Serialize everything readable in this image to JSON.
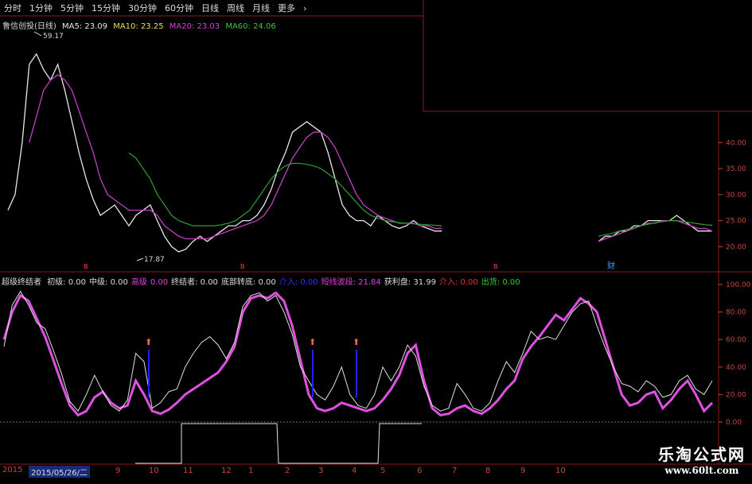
{
  "topbar": {
    "tabs": [
      "分时",
      "1分钟",
      "5分钟",
      "15分钟",
      "30分钟",
      "60分钟",
      "日线",
      "周线",
      "月线",
      "更多",
      "›"
    ]
  },
  "stock_header": {
    "name": "鲁信创投(日线)",
    "ma5": "MA5: 23.09",
    "ma10": "MA10: 23.25",
    "ma20": "MA20: 23.03",
    "ma60": "MA60: 24.06"
  },
  "indicator_header": {
    "name": "超级终结者",
    "items": [
      {
        "text": "初级: 0.00",
        "color": "#dddddd"
      },
      {
        "text": "中级: 0.00",
        "color": "#dddddd"
      },
      {
        "text": "高级",
        "color": "#e040e0"
      },
      {
        "text": "0.00",
        "color": "#e040e0"
      },
      {
        "text": "终结者: 0.00",
        "color": "#dddddd"
      },
      {
        "text": "底部转底: 0.00",
        "color": "#dddddd"
      },
      {
        "text": "介入: 0.00",
        "color": "#3030ff"
      },
      {
        "text": "短线波段: 21.84",
        "color": "#e040e0"
      },
      {
        "text": "获利盘: 31.99",
        "color": "#dddddd"
      },
      {
        "text": "介入: 0.00",
        "color": "#e03030"
      },
      {
        "text": "出货: 0.00",
        "color": "#30d030"
      }
    ]
  },
  "annotations": {
    "high": "59.17",
    "low": "17.87",
    "events": [
      "B",
      "B",
      "财"
    ]
  },
  "bottombar": {
    "year": "2015",
    "date": "2015/05/26/二",
    "months": [
      "9",
      "10",
      "11",
      "12",
      "1",
      "2",
      "3",
      "4",
      "5",
      "6",
      "7",
      "8",
      "9",
      "10"
    ]
  },
  "watermark": {
    "title": "乐淘公式网",
    "url": "www.60lt.com"
  },
  "colors": {
    "price_line": "#e8e8e8",
    "ma20": "#c040c0",
    "ma60": "#30a030",
    "ind_main": "#e050e0",
    "ind_white": "#e0e0e0",
    "axis_red": "#c8463c",
    "signal_blue": "#2020ff"
  },
  "chart_data": [
    {
      "type": "line",
      "title": "鲁信创投(日线)",
      "y_ticks": [
        20.0,
        25.0,
        30.0,
        35.0,
        40.0
      ],
      "ylim": [
        17,
        46
      ],
      "series": [
        {
          "name": "MA5",
          "values": [
            27,
            30,
            40,
            55,
            57,
            54,
            52,
            55,
            50,
            44,
            38,
            33,
            29,
            26,
            27,
            28,
            26,
            24,
            26,
            27,
            28,
            25,
            22,
            20,
            19,
            19.5,
            21,
            22,
            21,
            22,
            23,
            24,
            24,
            25,
            25,
            26,
            28,
            31,
            35,
            38,
            42,
            43,
            44,
            43,
            42,
            38,
            33,
            28,
            26,
            25,
            25,
            24,
            26,
            25,
            24,
            23.5,
            24,
            25,
            24,
            23.5,
            23,
            23,
            null,
            null,
            null,
            null,
            null,
            null,
            null,
            null,
            null,
            null,
            null,
            null,
            null,
            null,
            null,
            null,
            null,
            null,
            null,
            null,
            null,
            21,
            22,
            22,
            23,
            23,
            24,
            24,
            25,
            25,
            25,
            25,
            26,
            25,
            24,
            23,
            23,
            23
          ]
        },
        {
          "name": "MA20",
          "values": [
            null,
            null,
            null,
            40,
            45,
            50,
            52,
            53,
            52,
            50,
            46,
            42,
            38,
            33,
            30,
            29,
            28,
            27,
            27,
            27,
            27,
            26,
            24,
            23,
            22,
            21.5,
            21.5,
            21.5,
            21.5,
            22,
            22.5,
            23,
            23.5,
            24,
            24.5,
            25,
            26,
            28,
            31,
            34,
            37,
            39,
            41,
            42,
            42,
            41,
            39,
            36,
            33,
            30,
            28,
            27,
            26,
            25.5,
            25,
            24.5,
            24.5,
            24.5,
            24,
            24,
            23.5,
            23.5,
            null,
            null,
            null,
            null,
            null,
            null,
            null,
            null,
            null,
            null,
            null,
            null,
            null,
            null,
            null,
            null,
            null,
            null,
            null,
            null,
            null,
            21,
            21.5,
            22,
            22.5,
            23,
            23.5,
            24,
            24.5,
            24.5,
            25,
            25,
            25,
            24.5,
            24,
            23.5,
            23.5,
            23
          ]
        },
        {
          "name": "MA60",
          "values": [
            null,
            null,
            null,
            null,
            null,
            null,
            null,
            null,
            null,
            null,
            null,
            null,
            null,
            null,
            null,
            null,
            null,
            38,
            37,
            35,
            33,
            30,
            28,
            26,
            25,
            24.5,
            24,
            24,
            24,
            24,
            24.2,
            24.5,
            25,
            26,
            27,
            29,
            31,
            33,
            34.5,
            35.5,
            36,
            36,
            35.8,
            35.5,
            35,
            34,
            33,
            31.5,
            30,
            28.5,
            27,
            26,
            25.5,
            25,
            24.8,
            24.6,
            24.5,
            24.4,
            24.3,
            24.2,
            24.1,
            24,
            null,
            null,
            null,
            null,
            null,
            null,
            null,
            null,
            null,
            null,
            null,
            null,
            null,
            null,
            null,
            null,
            null,
            null,
            null,
            null,
            null,
            22,
            22.3,
            22.6,
            23,
            23.3,
            23.6,
            24,
            24.3,
            24.6,
            24.8,
            25,
            25,
            24.8,
            24.6,
            24.4,
            24.2,
            24.1
          ]
        }
      ]
    },
    {
      "type": "line",
      "title": "超级终结者",
      "y_ticks": [
        0.0,
        20.0,
        40.0,
        60.0,
        80.0,
        100.0
      ],
      "ylim": [
        0,
        100
      ],
      "series": [
        {
          "name": "短线波段",
          "values": [
            60,
            80,
            92,
            88,
            75,
            62,
            45,
            28,
            12,
            5,
            8,
            18,
            22,
            14,
            10,
            12,
            30,
            20,
            8,
            6,
            9,
            14,
            20,
            24,
            28,
            32,
            36,
            44,
            55,
            80,
            90,
            92,
            90,
            94,
            88,
            70,
            45,
            20,
            10,
            8,
            10,
            14,
            12,
            10,
            8,
            10,
            16,
            24,
            34,
            50,
            56,
            30,
            10,
            5,
            6,
            10,
            12,
            8,
            6,
            10,
            16,
            24,
            30,
            46,
            55,
            62,
            70,
            78,
            74,
            82,
            90,
            86,
            80,
            60,
            40,
            20,
            12,
            14,
            20,
            22,
            10,
            16,
            24,
            30,
            20,
            8,
            14
          ]
        },
        {
          "name": "获利盘",
          "values": [
            55,
            85,
            95,
            85,
            72,
            68,
            52,
            35,
            15,
            8,
            20,
            34,
            22,
            12,
            8,
            16,
            50,
            44,
            10,
            14,
            22,
            24,
            40,
            50,
            58,
            62,
            56,
            46,
            58,
            84,
            92,
            94,
            88,
            92,
            80,
            64,
            40,
            30,
            20,
            16,
            26,
            40,
            20,
            12,
            10,
            20,
            40,
            30,
            40,
            56,
            48,
            26,
            12,
            8,
            10,
            28,
            20,
            10,
            8,
            14,
            30,
            44,
            36,
            50,
            66,
            60,
            62,
            60,
            70,
            80,
            86,
            88,
            70,
            54,
            40,
            28,
            26,
            22,
            30,
            26,
            18,
            20,
            30,
            34,
            24,
            20,
            30
          ]
        }
      ]
    }
  ]
}
